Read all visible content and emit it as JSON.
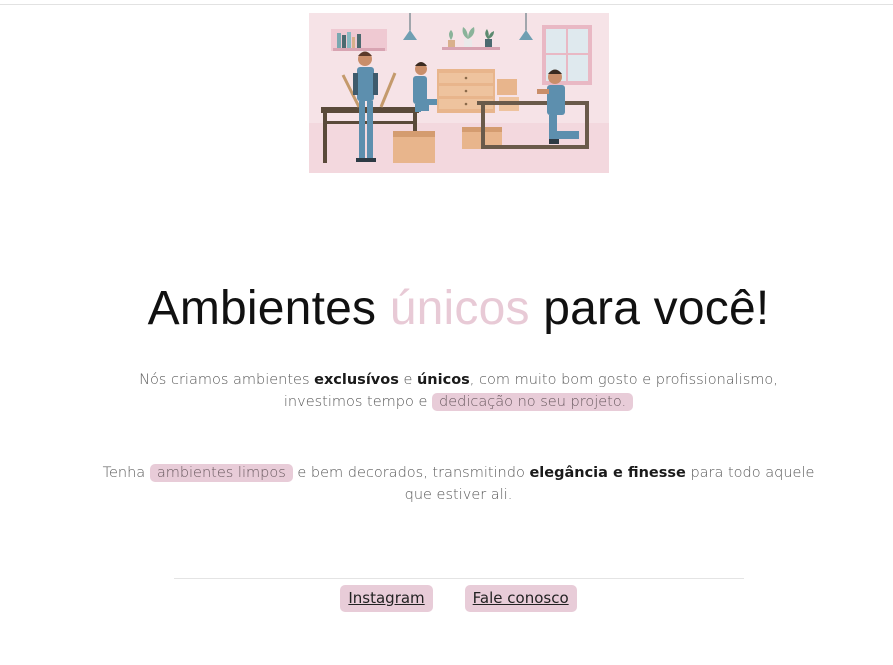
{
  "hero": {
    "illustration": "workers-assembling-furniture-illustration"
  },
  "headline": {
    "part1": "Ambientes ",
    "accent": "únicos",
    "part2": " para você!"
  },
  "paragraph1": {
    "t1": "Nós criamos ambientes ",
    "b1": "exclusívos",
    "t2": " e ",
    "b2": "únicos",
    "t3": ", com muito bom gosto e profissionalismo, investimos tempo e ",
    "highlight": "dedicação no seu projeto."
  },
  "paragraph2": {
    "t1": "Tenha ",
    "highlight": "ambientes limpos",
    "t2": " e bem decorados, transmitindo ",
    "b1": "elegância e finesse",
    "t3": " para todo aquele que estiver ali."
  },
  "footer": {
    "instagram_label": "Instagram",
    "contact_label": "Fale conosco"
  },
  "colors": {
    "accent": "#e8cad6",
    "highlight_bg": "#e8ccd8",
    "illustration_bg": "#f6e4e8"
  }
}
